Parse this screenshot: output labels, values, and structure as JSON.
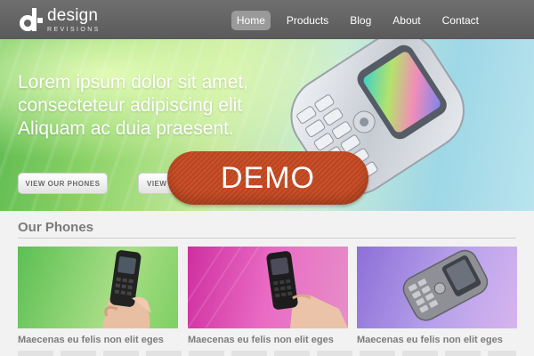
{
  "header": {
    "logo_word": "design",
    "logo_sub": "REVISIONS",
    "nav": [
      {
        "label": "Home",
        "active": true
      },
      {
        "label": "Products",
        "active": false
      },
      {
        "label": "Blog",
        "active": false
      },
      {
        "label": "About",
        "active": false
      },
      {
        "label": "Contact",
        "active": false
      }
    ]
  },
  "hero": {
    "headline_lines": [
      "Lorem ipsum dolor sit amet,",
      "consecteteur adipiscing elit",
      "Aliquam ac duia praesent."
    ],
    "button_primary": "VIEW OUR PHONES",
    "button_secondary": "VIEW",
    "demo_label": "DEMO"
  },
  "phones_section": {
    "title": "Our Phones",
    "cards": [
      {
        "title": "Maecenas eu felis non elit eges",
        "bg": "#5cbf53"
      },
      {
        "title": "Maecenas eu felis non elit eges",
        "bg": "#cf2fa0"
      },
      {
        "title": "Maecenas eu felis non elit eges",
        "bg": "#8d6fd8"
      }
    ]
  },
  "colors": {
    "topbar": "#5f5f5f",
    "nav_active": "#9a9a9a",
    "demo": "#c24b25",
    "section_title": "#7a7a7a"
  }
}
